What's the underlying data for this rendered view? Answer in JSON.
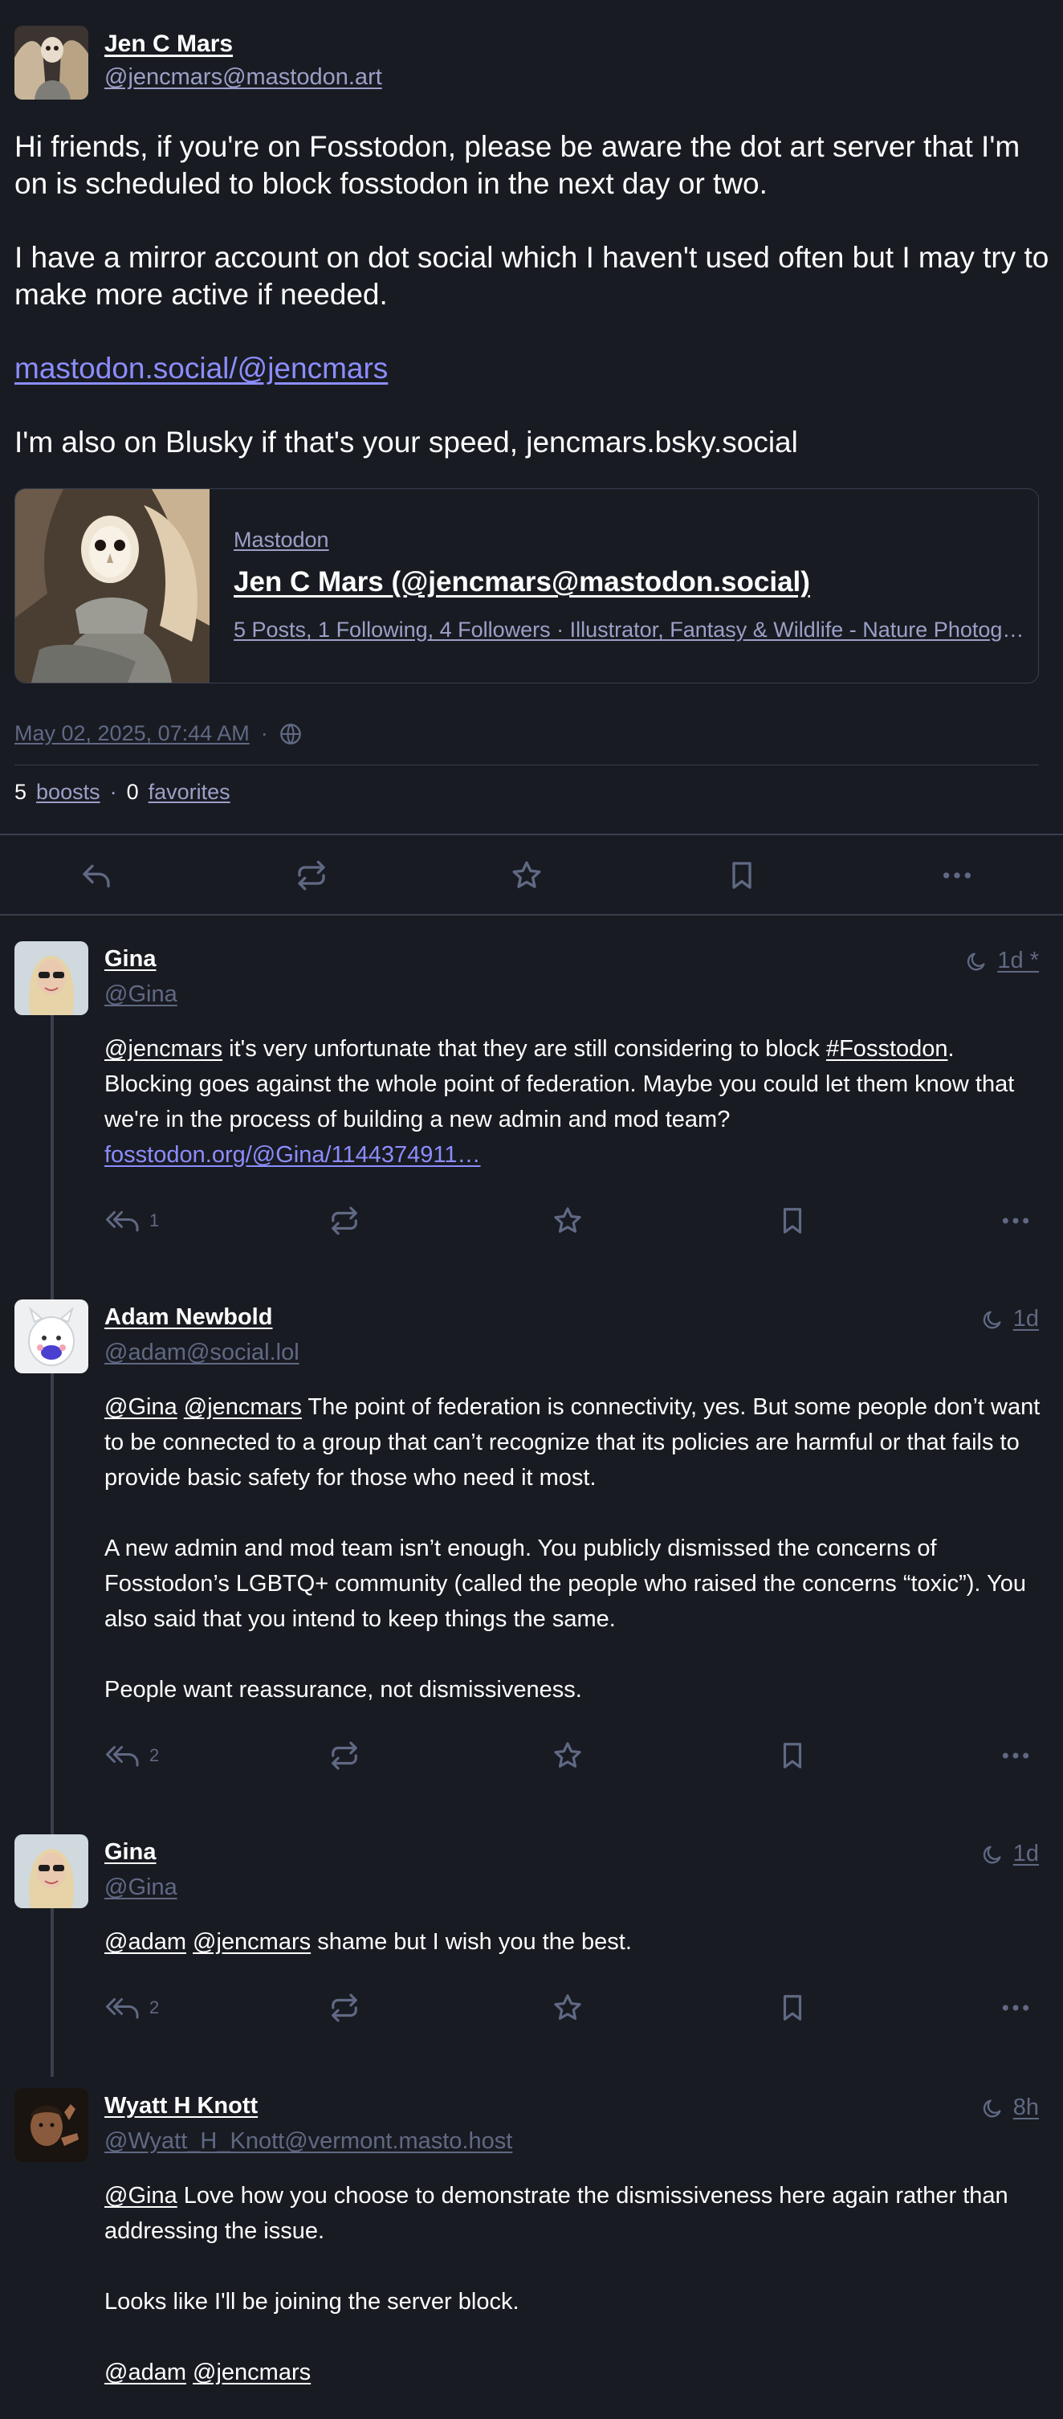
{
  "main": {
    "author_name": "Jen C Mars",
    "author_handle": "@jencmars@mastodon.art",
    "paragraphs": [
      "Hi friends, if you're on Fosstodon, please be aware the dot art server that I'm on is scheduled to block fosstodon in the next day or two.",
      "I have a mirror account on dot social which I haven't used often but I may try to make more active if needed.",
      "I'm also on Blusky if that's your speed, jencmars.bsky.social"
    ],
    "link_text": "mastodon.social/@jencmars",
    "card": {
      "provider": "Mastodon",
      "title": "Jen C Mars (@jencmars@mastodon.social)",
      "description": "5 Posts, 1 Following, 4 Followers · Illustrator, Fantasy & Wildlife - Nature Photographer"
    },
    "date": "May 02, 2025, 07:44 AM",
    "separator": "·",
    "boosts_count": "5",
    "boosts_label": "boosts",
    "favorites_count": "0",
    "favorites_label": "favorites"
  },
  "replies": [
    {
      "name": "Gina",
      "handle": "@Gina",
      "time": "1d *",
      "mention1": "@jencmars",
      "text1": " it's very unfortunate that they are still considering to block ",
      "hashtag": "#Fosstodon",
      "text2": ". Blocking goes against the whole point of federation. Maybe you could let them know that we're in the process of building a new admin and mod team? ",
      "link": "fosstodon.org/@Gina/1144374911…",
      "reply_count": "1"
    },
    {
      "name": "Adam Newbold",
      "handle": "@adam@social.lol",
      "time": "1d",
      "mention1": "@Gina",
      "mention2": "@jencmars",
      "text1": " The point of federation is connectivity, yes. But some people don’t want to be connected to a group that can’t recognize that its policies are harmful or that fails to provide basic safety for those who need it most.",
      "para2": "A new admin and mod team isn’t enough. You publicly dismissed the concerns of Fosstodon’s LGBTQ+ community (called the people who raised the concerns “toxic”). You also said that you intend to keep things the same.",
      "para3": "People want reassurance, not dismissiveness.",
      "reply_count": "2"
    },
    {
      "name": "Gina",
      "handle": "@Gina",
      "time": "1d",
      "mention1": "@adam",
      "mention2": "@jencmars",
      "text1": " shame but I wish you the best.",
      "reply_count": "2"
    },
    {
      "name": "Wyatt H Knott",
      "handle": "@Wyatt_H_Knott@vermont.masto.host",
      "time": "8h",
      "mention1": "@Gina",
      "text1": " Love how you choose to demonstrate the dismissiveness here again rather than addressing the issue.",
      "para2": "Looks like I'll be joining the server block.",
      "mention2": "@adam",
      "mention3": "@jencmars"
    }
  ],
  "icons": [
    "reply-icon",
    "boost-icon",
    "star-icon",
    "bookmark-icon",
    "more-icon",
    "globe-icon",
    "moon-icon",
    "reply-all-icon"
  ],
  "colors": {
    "background": "#191b22",
    "muted": "#606984",
    "secondary": "#9ba0c7",
    "link": "#8c8dff",
    "border": "#393f4f"
  }
}
